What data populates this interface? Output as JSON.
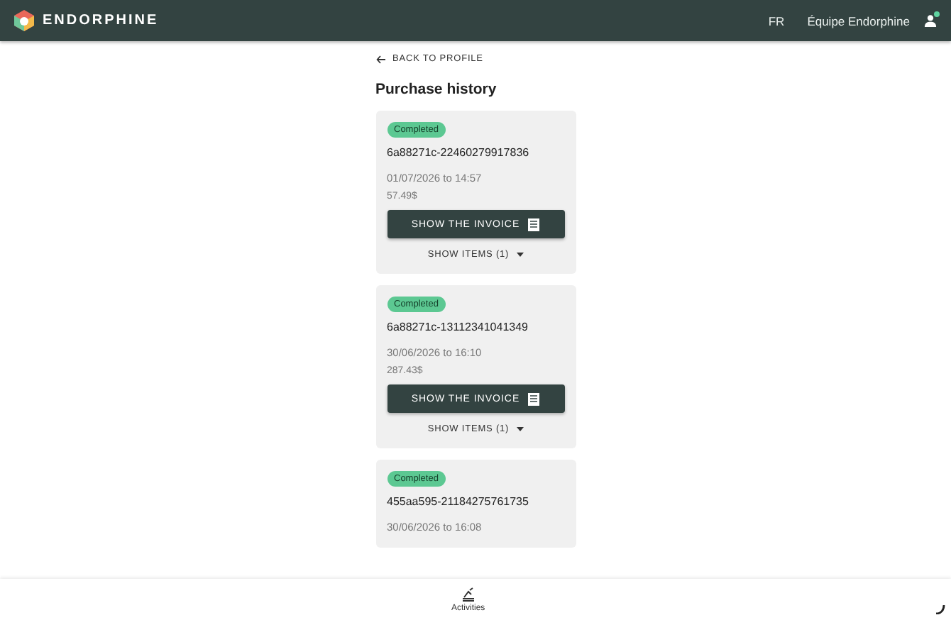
{
  "header": {
    "brand": "ENDORPHINE",
    "language": "FR",
    "user": "Équipe Endorphine",
    "notification": true
  },
  "back_link": "BACK TO PROFILE",
  "title": "Purchase history",
  "purchases": [
    {
      "status": "Completed",
      "order_id": "6a88271c-22460279917836",
      "date": "01/07/2026 to 14:57",
      "price": "57.49$",
      "invoice_button": "SHOW THE INVOICE",
      "items_toggle": "SHOW ITEMS (1)",
      "expanded": false
    },
    {
      "status": "Completed",
      "order_id": "6a88271c-13112341041349",
      "date": "30/06/2026 to 16:10",
      "price": "287.43$",
      "invoice_button": "SHOW THE INVOICE",
      "items_toggle": "SHOW ITEMS (1)",
      "expanded": false
    },
    {
      "status": "Completed",
      "order_id": "455aa595-21184275761735",
      "date": "30/06/2026 to 16:08"
    }
  ],
  "bottom_nav": [
    {
      "label": "Activities",
      "selected": true
    }
  ]
}
